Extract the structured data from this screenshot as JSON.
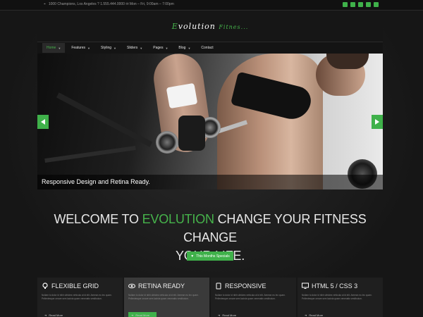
{
  "topbar": {
    "address": "1000 Champions, Los Angeles ? 1.555.444.0000 ✉ Mon – Fri, 9:00am – 7:00pm",
    "social_icons": [
      "facebook-icon",
      "twitter-icon",
      "google-plus-icon",
      "youtube-icon",
      "email-icon"
    ]
  },
  "brand": {
    "name_prefix": "E",
    "name_rest": "volution",
    "sub": "Fitnes..."
  },
  "nav": {
    "items": [
      {
        "label": "Home",
        "active": true,
        "dropdown": true
      },
      {
        "label": "Features",
        "dropdown": true
      },
      {
        "label": "Styling",
        "dropdown": true
      },
      {
        "label": "Sliders",
        "dropdown": true
      },
      {
        "label": "Pages",
        "dropdown": true
      },
      {
        "label": "Blog",
        "dropdown": true
      },
      {
        "label": "Contact",
        "dropdown": false
      }
    ]
  },
  "hero": {
    "caption": "Responsive Design and Retina Ready."
  },
  "welcome": {
    "line_a": "WELCOME TO ",
    "highlight": "EVOLUTION",
    "line_b": " CHANGE YOUR FITNESS CHANGE",
    "line_c": "YOUR LIFE."
  },
  "cta": {
    "label": "This Months Specials"
  },
  "features": [
    {
      "title": "FLEXIBLE GRID",
      "icon": "lightbulb-icon",
      "text": "Nullam to dolor id nibh ultricies vehicula ut id elit. Aenean eu leo quam. Pellentesque ornare sem lacinia quam venenatis vestibulum.",
      "more": "Read More"
    },
    {
      "title": "RETINA READY",
      "icon": "eye-icon",
      "text": "Nullam to dolor id nibh ultricies vehicula ut id elit. Aenean eu leo quam. Pellentesque ornare sem lacinia quam venenatis vestibulum.",
      "more": "Read More"
    },
    {
      "title": "RESPONSIVE",
      "icon": "tablet-icon",
      "text": "Nullam to dolor id nibh ultricies vehicula ut id elit. Aenean eu leo quam. Pellentesque ornare sem lacinia quam venenatis vestibulum.",
      "more": "Read More"
    },
    {
      "title": "HTML 5 / CSS 3",
      "icon": "monitor-icon",
      "text": "Nullam to dolor id nibh ultricies vehicula ut id elit. Aenean eu leo quam. Pellentesque ornare sem lacinia quam venenatis vestibulum.",
      "more": "Read More"
    }
  ],
  "colors": {
    "accent": "#46b34b",
    "background": "#1b1b1b"
  }
}
